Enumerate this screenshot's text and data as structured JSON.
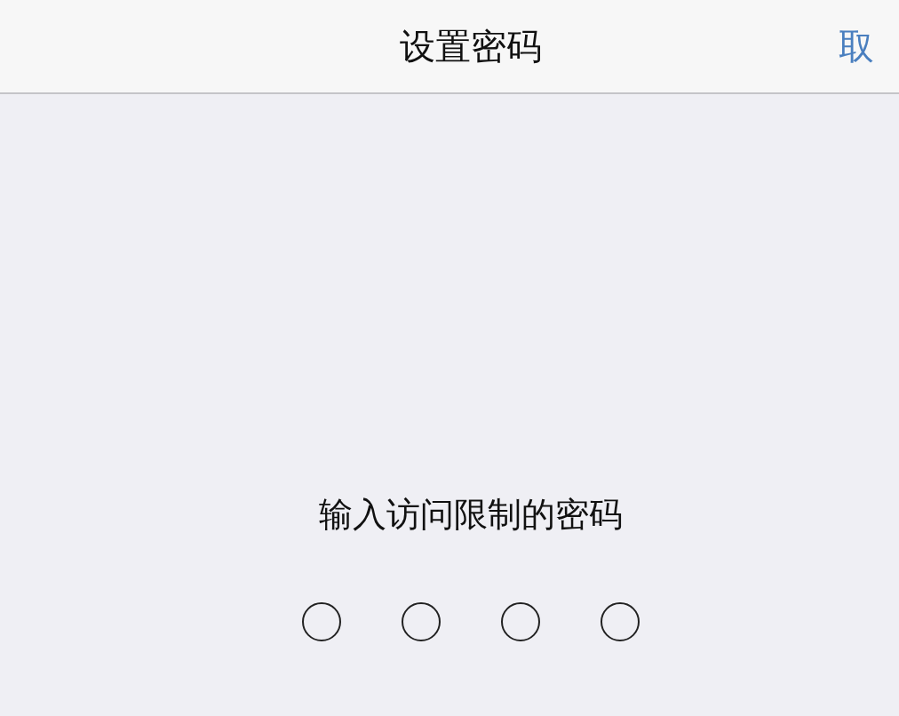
{
  "nav_bar": {
    "title": "设置密码",
    "cancel_button": "取"
  },
  "prompt": "输入访问限制的密码",
  "passcode_dots": [
    {
      "filled": false
    },
    {
      "filled": false
    },
    {
      "filled": false
    },
    {
      "filled": false
    }
  ]
}
